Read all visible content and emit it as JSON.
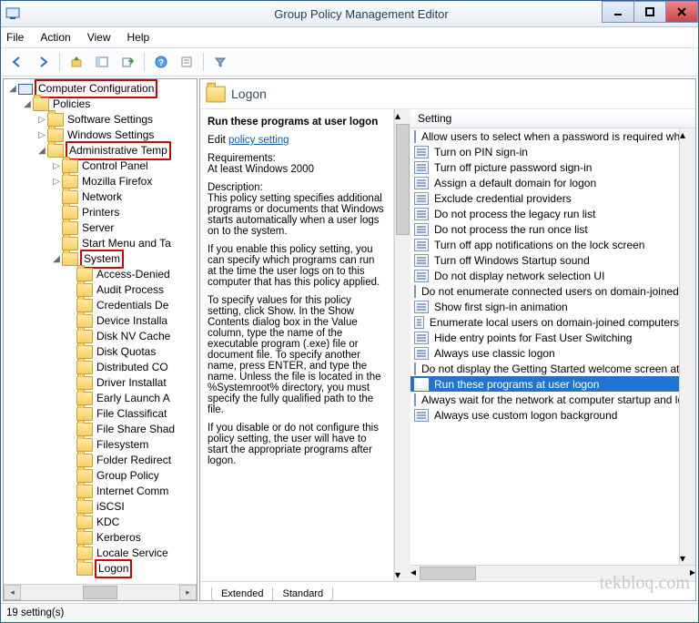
{
  "title": "Group Policy Management Editor",
  "menu": [
    "File",
    "Action",
    "View",
    "Help"
  ],
  "tree": [
    {
      "d": 0,
      "exp": "▣",
      "icon": "comp",
      "label": "Computer Configuration",
      "mark": true
    },
    {
      "d": 1,
      "exp": "▣",
      "icon": "folder",
      "label": "Policies"
    },
    {
      "d": 2,
      "exp": "▶",
      "icon": "folder",
      "label": "Software Settings"
    },
    {
      "d": 2,
      "exp": "▶",
      "icon": "folder",
      "label": "Windows Settings"
    },
    {
      "d": 2,
      "exp": "▣",
      "icon": "folder",
      "label": "Administrative Temp",
      "mark": true
    },
    {
      "d": 3,
      "exp": "▶",
      "icon": "folder",
      "label": "Control Panel"
    },
    {
      "d": 3,
      "exp": "▶",
      "icon": "folder",
      "label": "Mozilla Firefox"
    },
    {
      "d": 3,
      "exp": " ",
      "icon": "folder",
      "label": "Network"
    },
    {
      "d": 3,
      "exp": " ",
      "icon": "folder",
      "label": "Printers"
    },
    {
      "d": 3,
      "exp": " ",
      "icon": "folder",
      "label": "Server"
    },
    {
      "d": 3,
      "exp": " ",
      "icon": "folder",
      "label": "Start Menu and Ta"
    },
    {
      "d": 3,
      "exp": "▣",
      "icon": "folder",
      "label": "System",
      "mark": true
    },
    {
      "d": 4,
      "exp": " ",
      "icon": "folder",
      "label": "Access-Denied"
    },
    {
      "d": 4,
      "exp": " ",
      "icon": "folder",
      "label": "Audit Process"
    },
    {
      "d": 4,
      "exp": " ",
      "icon": "folder",
      "label": "Credentials De"
    },
    {
      "d": 4,
      "exp": " ",
      "icon": "folder",
      "label": "Device Installa"
    },
    {
      "d": 4,
      "exp": " ",
      "icon": "folder",
      "label": "Disk NV Cache"
    },
    {
      "d": 4,
      "exp": " ",
      "icon": "folder",
      "label": "Disk Quotas"
    },
    {
      "d": 4,
      "exp": " ",
      "icon": "folder",
      "label": "Distributed CO"
    },
    {
      "d": 4,
      "exp": " ",
      "icon": "folder",
      "label": "Driver Installat"
    },
    {
      "d": 4,
      "exp": " ",
      "icon": "folder",
      "label": "Early Launch A"
    },
    {
      "d": 4,
      "exp": " ",
      "icon": "folder",
      "label": "File Classificat"
    },
    {
      "d": 4,
      "exp": " ",
      "icon": "folder",
      "label": "File Share Shad"
    },
    {
      "d": 4,
      "exp": " ",
      "icon": "folder",
      "label": "Filesystem"
    },
    {
      "d": 4,
      "exp": " ",
      "icon": "folder",
      "label": "Folder Redirect"
    },
    {
      "d": 4,
      "exp": " ",
      "icon": "folder",
      "label": "Group Policy"
    },
    {
      "d": 4,
      "exp": " ",
      "icon": "folder",
      "label": "Internet Comm"
    },
    {
      "d": 4,
      "exp": " ",
      "icon": "folder",
      "label": "iSCSI"
    },
    {
      "d": 4,
      "exp": " ",
      "icon": "folder",
      "label": "KDC"
    },
    {
      "d": 4,
      "exp": " ",
      "icon": "folder",
      "label": "Kerberos"
    },
    {
      "d": 4,
      "exp": " ",
      "icon": "folder",
      "label": "Locale Service"
    },
    {
      "d": 4,
      "exp": " ",
      "icon": "folder",
      "label": "Logon",
      "mark": true
    }
  ],
  "right": {
    "heading": "Logon",
    "detail_title": "Run these programs at user logon",
    "edit_label": "Edit",
    "edit_link": "policy setting",
    "req_label": "Requirements:",
    "req_value": "At least Windows 2000",
    "desc_label": "Description:",
    "desc1": "This policy setting specifies additional programs or documents that Windows starts automatically when a user logs on to the system.",
    "desc2": "If you enable this policy setting, you can specify which programs can run at the time the user logs on to this computer that has this policy applied.",
    "desc3": "To specify values for this policy setting, click Show. In the Show Contents dialog box in the Value column, type the name of the executable program (.exe) file or document file. To specify another name, press ENTER, and type the name. Unless the file is located in the %Systemroot% directory, you must specify the fully qualified path to the file.",
    "desc4": "If you disable or do not configure this policy setting, the user will have to start the appropriate programs after logon.",
    "settings_header": "Setting",
    "settings": [
      "Allow users to select when a password is required when resu…",
      "Turn on PIN sign-in",
      "Turn off picture password sign-in",
      "Assign a default domain for logon",
      "Exclude credential providers",
      "Do not process the legacy run list",
      "Do not process the run once list",
      "Turn off app notifications on the lock screen",
      "Turn off Windows Startup sound",
      "Do not display network selection UI",
      "Do not enumerate connected users on domain-joined com…",
      "Show first sign-in animation",
      "Enumerate local users on domain-joined computers",
      "Hide entry points for Fast User Switching",
      "Always use classic logon",
      "Do not display the Getting Started welcome screen at logon",
      "Run these programs at user logon",
      "Always wait for the network at computer startup and logon",
      "Always use custom logon background"
    ],
    "selected_index": 16
  },
  "tabs": [
    "Extended",
    "Standard"
  ],
  "status": "19 setting(s)",
  "watermark": "tekbloq.com"
}
